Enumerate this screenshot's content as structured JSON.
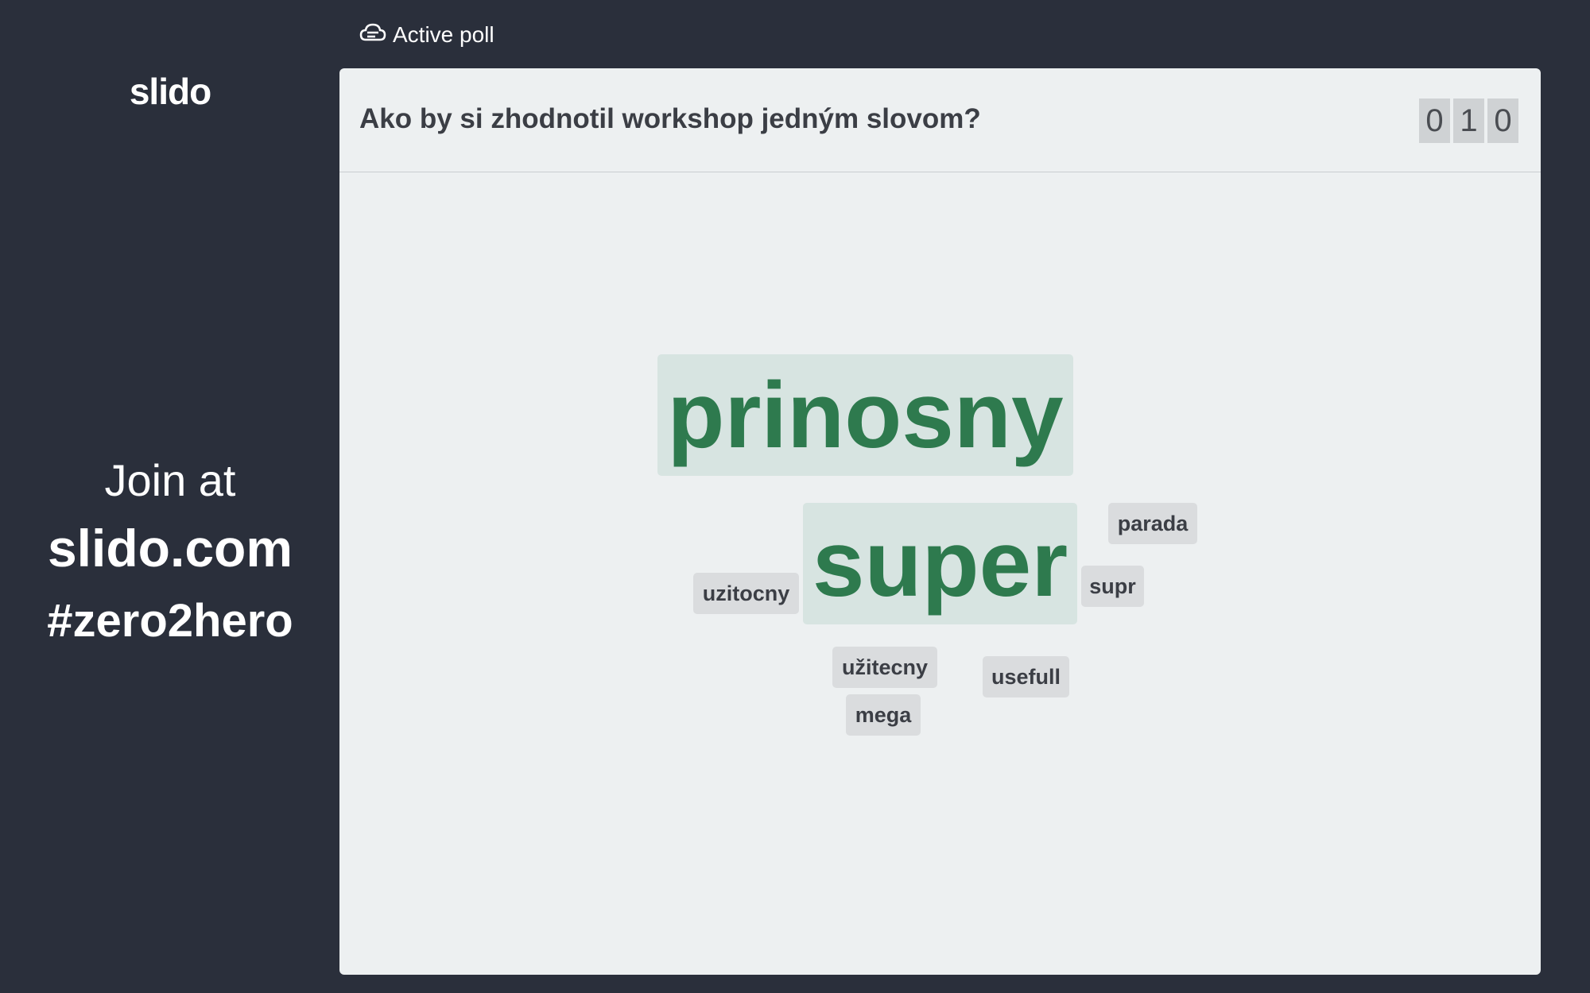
{
  "sidebar": {
    "logo": "slido",
    "join_line1": "Join at",
    "join_url": "slido.com",
    "event_code": "#zero2hero"
  },
  "status": {
    "icon": "poll-cloud-icon",
    "label": "Active poll"
  },
  "poll": {
    "question": "Ako by si zhodnotil workshop jedným slovom?",
    "response_count_digits": [
      "0",
      "1",
      "0"
    ],
    "words": [
      {
        "text": "prinosny"
      },
      {
        "text": "super"
      },
      {
        "text": "parada"
      },
      {
        "text": "supr"
      },
      {
        "text": "uzitocny"
      },
      {
        "text": "užitecny"
      },
      {
        "text": "usefull"
      },
      {
        "text": "mega"
      }
    ]
  },
  "colors": {
    "background": "#2a2f3b",
    "panel": "#edf0f1",
    "accent_green": "#2e7a4e",
    "highlight_bg": "#d7e4e1",
    "chip_bg": "#dadcde",
    "text_dark": "#3b3e45"
  }
}
